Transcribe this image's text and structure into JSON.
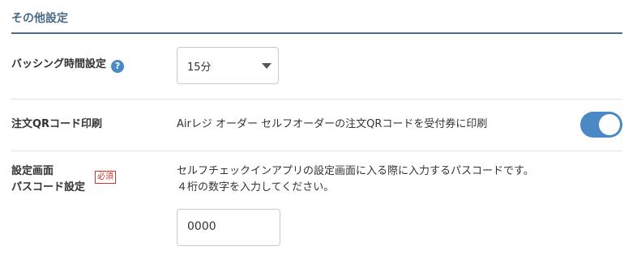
{
  "section": {
    "title": "その他設定"
  },
  "bussing": {
    "label": "バッシング時間設定",
    "help_icon_glyph": "?",
    "selected_value": "15分"
  },
  "qr_print": {
    "label": "注文QRコード印刷",
    "description": "Airレジ オーダー セルフオーダーの注文QRコードを受付券に印刷",
    "toggle_on": true
  },
  "passcode": {
    "label_line1": "設定画面",
    "label_line2": "パスコード設定",
    "required_badge": "必須",
    "description_line1": "セルフチェックインアプリの設定画面に入る際に入力するパスコードです。",
    "description_line2": "４桁の数字を入力してください。",
    "value": "0000"
  },
  "colors": {
    "accent": "#4a6b85",
    "toggle": "#4a89c5",
    "required": "#d0362b"
  }
}
